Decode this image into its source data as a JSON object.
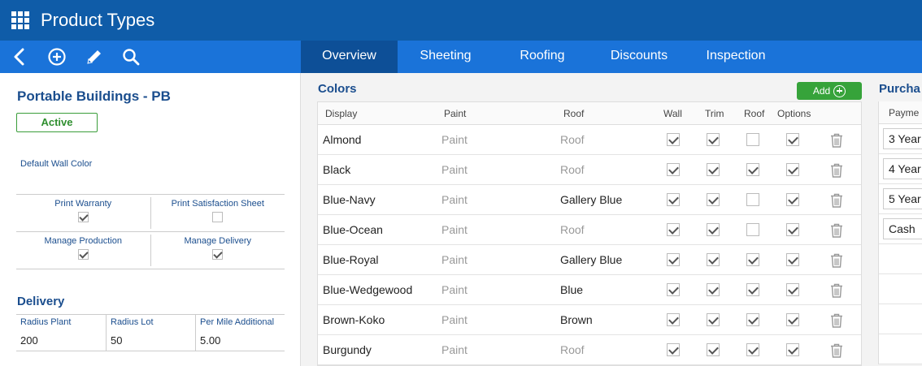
{
  "app": {
    "title": "Product Types"
  },
  "toolbar": {
    "icons": [
      "back-icon",
      "add-circle-icon",
      "edit-pencil-icon",
      "search-icon"
    ]
  },
  "tabs": [
    {
      "label": "Overview",
      "active": true
    },
    {
      "label": "Sheeting",
      "active": false
    },
    {
      "label": "Roofing",
      "active": false
    },
    {
      "label": "Discounts",
      "active": false
    },
    {
      "label": "Inspection",
      "active": false
    }
  ],
  "building": {
    "title": "Portable Buildings - PB",
    "status": "Active",
    "default_wall_color_label": "Default Wall Color",
    "options": [
      {
        "label": "Print Warranty",
        "checked": true
      },
      {
        "label": "Print Satisfaction Sheet",
        "checked": false
      },
      {
        "label": "Manage Production",
        "checked": true
      },
      {
        "label": "Manage Delivery",
        "checked": true
      }
    ]
  },
  "delivery": {
    "title": "Delivery",
    "fields": [
      {
        "label": "Radius Plant",
        "value": "200"
      },
      {
        "label": "Radius Lot",
        "value": "50"
      },
      {
        "label": "Per Mile Additional",
        "value": "5.00"
      }
    ]
  },
  "colors": {
    "title": "Colors",
    "add_label": "Add",
    "headers": {
      "display": "Display",
      "paint": "Paint",
      "roof": "Roof",
      "wall": "Wall",
      "trim": "Trim",
      "roof_cb": "Roof",
      "options": "Options"
    },
    "rows": [
      {
        "display": "Almond",
        "paint": "Paint",
        "roof": "Roof",
        "roof_set": false,
        "wall": true,
        "trim": true,
        "roof_cb": false,
        "options": true
      },
      {
        "display": "Black",
        "paint": "Paint",
        "roof": "Roof",
        "roof_set": false,
        "wall": true,
        "trim": true,
        "roof_cb": true,
        "options": true
      },
      {
        "display": "Blue-Navy",
        "paint": "Paint",
        "roof": "Gallery Blue",
        "roof_set": true,
        "wall": true,
        "trim": true,
        "roof_cb": false,
        "options": true
      },
      {
        "display": "Blue-Ocean",
        "paint": "Paint",
        "roof": "Roof",
        "roof_set": false,
        "wall": true,
        "trim": true,
        "roof_cb": false,
        "options": true
      },
      {
        "display": "Blue-Royal",
        "paint": "Paint",
        "roof": "Gallery Blue",
        "roof_set": true,
        "wall": true,
        "trim": true,
        "roof_cb": true,
        "options": true
      },
      {
        "display": "Blue-Wedgewood",
        "paint": "Paint",
        "roof": "Blue",
        "roof_set": true,
        "wall": true,
        "trim": true,
        "roof_cb": true,
        "options": true
      },
      {
        "display": "Brown-Koko",
        "paint": "Paint",
        "roof": "Brown",
        "roof_set": true,
        "wall": true,
        "trim": true,
        "roof_cb": true,
        "options": true
      },
      {
        "display": "Burgundy",
        "paint": "Paint",
        "roof": "Roof",
        "roof_set": false,
        "wall": true,
        "trim": true,
        "roof_cb": true,
        "options": true
      }
    ]
  },
  "purchase": {
    "title": "Purcha",
    "header": "Payme",
    "options": [
      "3 Year",
      "4 Year",
      "5 Year",
      "Cash"
    ],
    "empty_rows": 4
  },
  "theme": {
    "primary": "#0f5ca8",
    "toolbar": "#1a73d9",
    "active_tab": "#0d4f97",
    "heading": "#1b4e8e",
    "success": "#36a33a"
  }
}
